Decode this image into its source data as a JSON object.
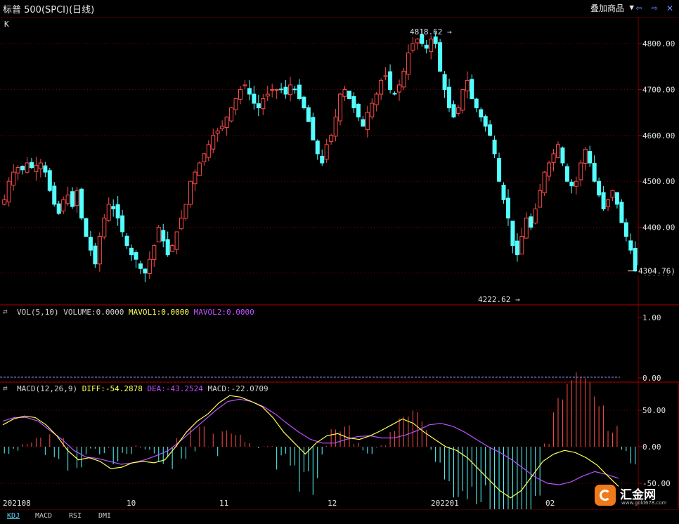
{
  "header": {
    "title": "标普 500(SPCI)(日线)",
    "overlay_label": "叠加商品",
    "prev_icon": "triangle-left-outline-icon",
    "next_icon": "triangle-right-outline-icon",
    "close_icon": "close-icon"
  },
  "price_panel": {
    "label": "K",
    "axis_ticks": [
      "4800.00",
      "4700.00",
      "4600.00",
      "4500.00",
      "4400.00",
      "4300.00"
    ],
    "high_annotation": "4818.62",
    "low_annotation": "4222.62",
    "last_price_marker": "4304.76"
  },
  "volume_panel": {
    "header": "VOL(5,10)",
    "volume_label": "VOLUME:0.0000",
    "mavol1_label": "MAVOL1:0.0000",
    "mavol2_label": "MAVOL2:0.0000",
    "axis_ticks": [
      "1.00",
      "0.00"
    ]
  },
  "macd_panel": {
    "header": "MACD(12,26,9)",
    "diff_label": "DIFF:-54.2878",
    "dea_label": "DEA:-43.2524",
    "macd_label": "MACD:-22.0709",
    "axis_ticks": [
      "50.00",
      "0.00",
      "-50.00"
    ]
  },
  "time_axis": [
    "202108",
    "10",
    "11",
    "12",
    "202201",
    "02"
  ],
  "bottom_tabs": [
    "KDJ",
    "MACD",
    "RSI",
    "DMI"
  ],
  "watermark": {
    "brand": "汇金网",
    "site": "www.gold678.com"
  },
  "colors": {
    "up": "#ff4a4a",
    "down": "#54ffff",
    "diff": "#ffff55",
    "dea": "#c050ff",
    "grid": "#7a0000",
    "axis_text": "#e0e0e0"
  },
  "chart_data": {
    "type": "candlestick",
    "count": 140,
    "ohlc_close_path": [
      4460,
      4500,
      4520,
      4530,
      4525,
      4540,
      4530,
      4535,
      4540,
      4520,
      4480,
      4450,
      4430,
      4460,
      4470,
      4445,
      4480,
      4420,
      4380,
      4350,
      4320,
      4380,
      4420,
      4450,
      4440,
      4420,
      4390,
      4360,
      4340,
      4330,
      4310,
      4300,
      4330,
      4360,
      4400,
      4370,
      4340,
      4360,
      4390,
      4420,
      4450,
      4500,
      4520,
      4540,
      4560,
      4580,
      4600,
      4610,
      4620,
      4640,
      4660,
      4680,
      4700,
      4710,
      4690,
      4670,
      4660,
      4680,
      4690,
      4700,
      4700,
      4700,
      4690,
      4710,
      4700,
      4680,
      4660,
      4630,
      4590,
      4560,
      4540,
      4580,
      4600,
      4640,
      4690,
      4700,
      4680,
      4660,
      4640,
      4620,
      4650,
      4670,
      4690,
      4720,
      4730,
      4700,
      4690,
      4710,
      4740,
      4780,
      4800,
      4810,
      4800,
      4790,
      4810,
      4800,
      4740,
      4700,
      4660,
      4640,
      4660,
      4700,
      4720,
      4680,
      4660,
      4640,
      4620,
      4600,
      4560,
      4500,
      4460,
      4420,
      4360,
      4340,
      4380,
      4420,
      4400,
      4440,
      4480,
      4520,
      4540,
      4560,
      4580,
      4540,
      4500,
      4490,
      4500,
      4540,
      4570,
      4540,
      4500,
      4470,
      4440,
      4460,
      4480,
      4450,
      4410,
      4380,
      4350,
      4304.76
    ],
    "diff": [
      30,
      38,
      42,
      40,
      30,
      15,
      -5,
      -18,
      -15,
      -20,
      -30,
      -28,
      -22,
      -20,
      -22,
      -18,
      0,
      20,
      35,
      45,
      60,
      70,
      68,
      62,
      55,
      40,
      20,
      5,
      -10,
      5,
      15,
      18,
      12,
      10,
      15,
      22,
      30,
      38,
      32,
      20,
      10,
      0,
      -5,
      -15,
      -30,
      -45,
      -60,
      -70,
      -60,
      -40,
      -20,
      -10,
      -5,
      -8,
      -15,
      -25,
      -40,
      -54.2878
    ],
    "dea": [
      35,
      40,
      40,
      35,
      22,
      10,
      -5,
      -14,
      -16,
      -20,
      -24,
      -22,
      -18,
      -12,
      -5,
      8,
      22,
      36,
      50,
      62,
      65,
      62,
      55,
      45,
      32,
      20,
      10,
      5,
      5,
      10,
      14,
      15,
      12,
      12,
      16,
      22,
      30,
      32,
      28,
      20,
      10,
      0,
      -8,
      -18,
      -30,
      -42,
      -50,
      -52,
      -48,
      -40,
      -34,
      -38,
      -43.2524
    ],
    "macd_last": -22.0709,
    "y_range": [
      4222.62,
      4818.62
    ]
  }
}
